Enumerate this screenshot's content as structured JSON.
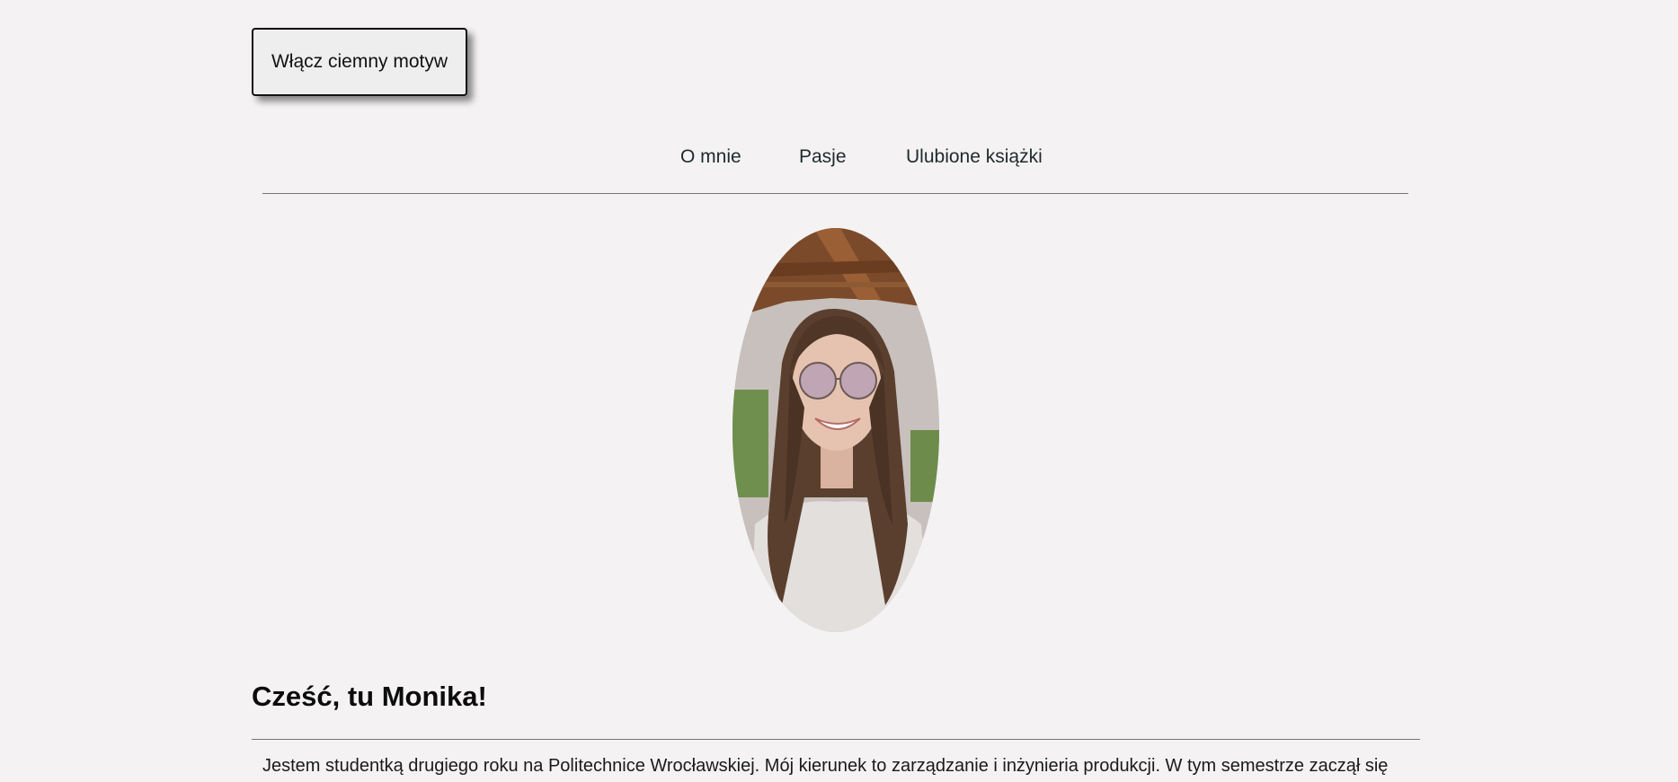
{
  "theme_button": {
    "label": "Włącz ciemny motyw"
  },
  "nav": {
    "items": [
      {
        "label": "O mnie"
      },
      {
        "label": "Pasje"
      },
      {
        "label": "Ulubione książki"
      }
    ]
  },
  "profile": {
    "photo_alt": "Monika",
    "heading": "Cześć, tu Monika!",
    "intro": "Jestem studentką drugiego roku na Politechnice Wrocławskiej. Mój kierunek to zarządzanie i inżynieria produkcji. W tym semestrze zaczął się"
  },
  "colors": {
    "background": "#f4f2f3",
    "button_bg": "#eeeeee",
    "divider": "#777777",
    "nav_text": "#1f2a2a"
  }
}
